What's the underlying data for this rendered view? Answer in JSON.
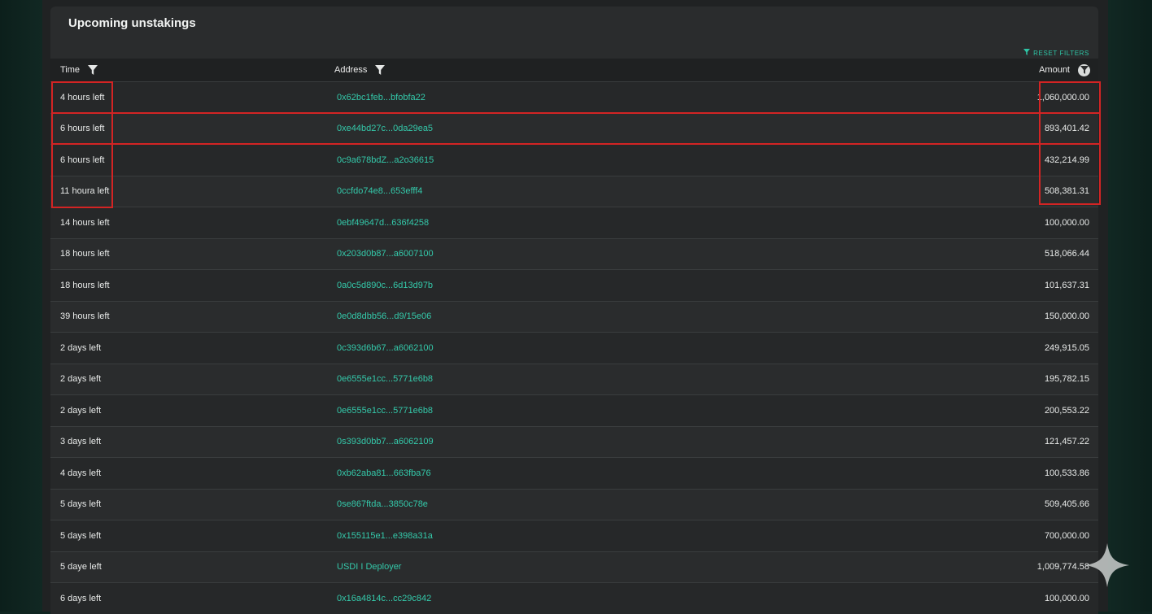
{
  "header": {
    "title": "Upcoming unstakings",
    "reset_label": "RESET FILTERS"
  },
  "columns": {
    "time": "Time",
    "address": "Address",
    "amount": "Amount"
  },
  "rows": [
    {
      "time": "4 hours left",
      "address": "0x62bc1feb...bfobfa22",
      "amount": "1,060,000.00"
    },
    {
      "time": "6 hours left",
      "address": "0xe44bd27c...0da29ea5",
      "amount": "893,401.42"
    },
    {
      "time": "6 hours left",
      "address": "0c9a678bdZ...a2o36615",
      "amount": "432,214.99"
    },
    {
      "time": "11 houra left",
      "address": "0ccfdo74e8...653efff4",
      "amount": "508,381.31"
    },
    {
      "time": "14 hours left",
      "address": "0ebf49647d...636f4258",
      "amount": "100,000.00"
    },
    {
      "time": "18 hours left",
      "address": "0x203d0b87...a6007100",
      "amount": "518,066.44"
    },
    {
      "time": "18 hours left",
      "address": "0a0c5d890c...6d13d97b",
      "amount": "101,637.31"
    },
    {
      "time": "39 hours left",
      "address": "0e0d8dbb56...d9/15e06",
      "amount": "150,000.00"
    },
    {
      "time": "2 days left",
      "address": "0c393d6b67...a6062100",
      "amount": "249,915.05"
    },
    {
      "time": "2 days left",
      "address": "0e6555e1cc...5771e6b8",
      "amount": "195,782.15"
    },
    {
      "time": "2 days left",
      "address": "0e6555e1cc...5771e6b8",
      "amount": "200,553.22"
    },
    {
      "time": "3 days left",
      "address": "0s393d0bb7...a6062109",
      "amount": "121,457.22"
    },
    {
      "time": "4 days left",
      "address": "0xb62aba81...663fba76",
      "amount": "100,533.86"
    },
    {
      "time": "5 days left",
      "address": "0se867ftda...3850c78e",
      "amount": "509,405.66"
    },
    {
      "time": "5 days left",
      "address": "0x155115e1...e398a31a",
      "amount": "700,000.00"
    },
    {
      "time": "5 daye left",
      "address": "USDI I Deployer",
      "amount": "1,009,774.58"
    },
    {
      "time": "6 days left",
      "address": "0x16a4814c...cc29c842",
      "amount": "100,000.00"
    }
  ],
  "colors": {
    "accent": "#2ec4a5",
    "highlight": "#d32424"
  },
  "icons": [
    "filter-icon",
    "sparkle-icon"
  ]
}
